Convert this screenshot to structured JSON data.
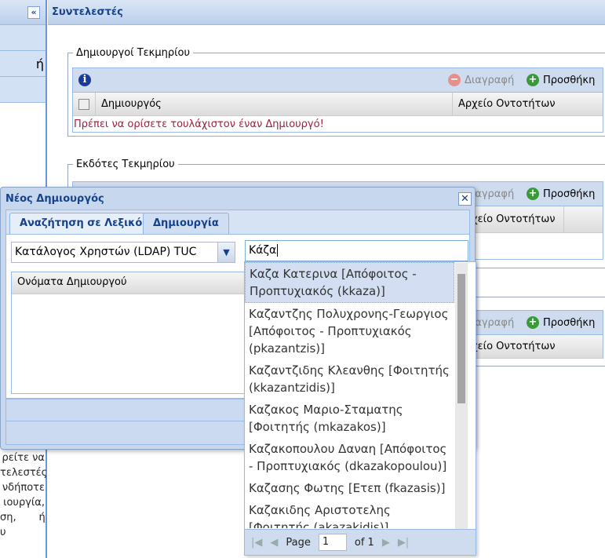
{
  "header": {
    "title": "Συντελεστές",
    "collapse_icon": "double-chevron-left"
  },
  "sidebar": {
    "items": [
      "",
      "ή",
      ""
    ]
  },
  "left_text_fragments": [
    "ρείτε να",
    "τελεστές",
    "νδήποτε",
    "ιουργία,",
    "ση,       ή",
    "υ"
  ],
  "creators": {
    "legend": "Δημιουργοί Τεκμηρίου",
    "delete": "Διαγραφή",
    "add": "Προσθήκη",
    "col_creator": "Δημιουργός",
    "col_authority": "Αρχείο Οντοτήτων",
    "error": "Πρέπει να ορίσετε τουλάχιστον έναν Δημιουργό!"
  },
  "publishers": {
    "legend": "Εκδότες Τεκμηρίου",
    "delete": "Διαγραφή",
    "add": "Προσθήκη",
    "col_authority": "Αρχείο Οντοτήτων"
  },
  "third": {
    "delete": "Διαγραφή",
    "add": "Προσθήκη",
    "col_authority": "Αρχείο Οντοτήτων"
  },
  "dialog": {
    "title": "Νέος Δημιουργός",
    "tabs": [
      "Αναζήτηση σε Λεξικό",
      "Δημιουργία"
    ],
    "combo_value": "Κατάλογος Χρηστών (LDAP) TUC",
    "search_value": "Κάζα",
    "names_header": "Ονόματα Δημιουργού"
  },
  "dropdown": {
    "items": [
      "Καζα Κατερινα [Απόφοιτος - Προπτυχιακός (kkaza)]",
      "Καζαντζης Πολυχρονης-Γεωργιος [Απόφοιτος - Προπτυχιακός (pkazantzis)]",
      "Καζαντζιδης Κλεανθης [Φοιτητής (kkazantzidis)]",
      "Καζακος Μαριο-Σταματης [Φοιτητής (mkazakos)]",
      "Καζακοπουλου Δαναη [Απόφοιτος - Προπτυχιακός (dkazakopoulou)]",
      "Καζασης Φωτης [Ετεπ (fkazasis)]",
      "Καζακιδης Αριστοτελης [Φοιτητής (akazakidis)]"
    ],
    "pager": {
      "page_label": "Page",
      "page": "1",
      "of": "of 1"
    }
  },
  "colors": {
    "accent": "#15428b",
    "error": "#a0203a",
    "toolbar": "#cfdcef",
    "border": "#99bbe8"
  }
}
